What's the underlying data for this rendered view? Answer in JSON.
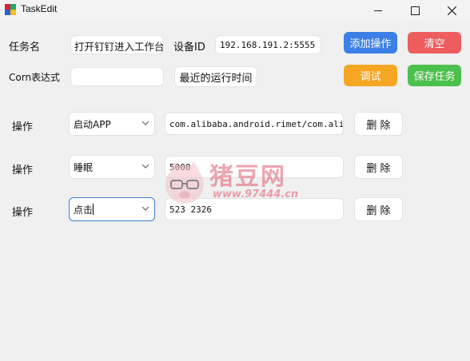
{
  "window": {
    "title": "TaskEdit"
  },
  "form": {
    "task_name_label": "任务名",
    "task_name_value": "打开钉钉进入工作台",
    "device_id_label": "设备ID",
    "device_id_value": "192.168.191.2:5555",
    "cron_label": "Corn表达式",
    "cron_value": "",
    "last_run_button": "最近的运行时间"
  },
  "buttons": {
    "add_op": "添加操作",
    "clear": "清空",
    "debug": "调试",
    "save": "保存任务"
  },
  "colors": {
    "add_op": "#3b80e6",
    "clear": "#ee5d5d",
    "debug": "#f5a623",
    "save": "#4cc04c"
  },
  "operations": [
    {
      "label": "操作",
      "type": "启动APP",
      "value": "com.alibaba.android.rimet/com.alibaba.android.rimet.",
      "delete": "删 除"
    },
    {
      "label": "操作",
      "type": "睡眠",
      "value": "5000",
      "delete": "删 除"
    },
    {
      "label": "操作",
      "type": "点击",
      "value": "523 2326",
      "delete": "删 除"
    }
  ],
  "watermark": {
    "text": "猪豆网",
    "url": "www.97444.cn"
  }
}
